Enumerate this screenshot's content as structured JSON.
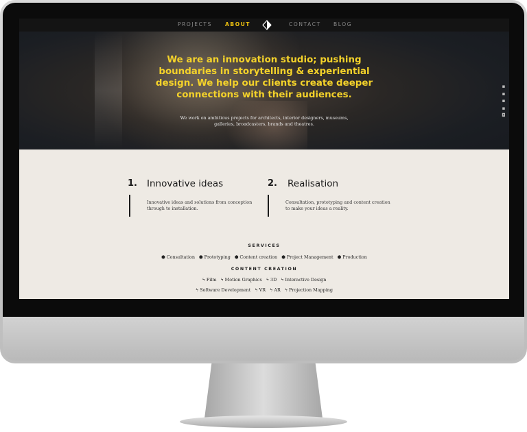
{
  "nav": {
    "items": [
      "PROJECTS",
      "ABOUT",
      "CONTACT",
      "BLOG"
    ],
    "active": "ABOUT"
  },
  "hero": {
    "title": "We are an innovation studio; pushing boundaries in storytelling & experiential design. We help our clients create deeper connections with their audiences.",
    "subtitle": "We work on ambitious projects for architects, interior designers, museums, galleries, broadcasters, brands and theatres."
  },
  "social": [
    "twitter-icon",
    "vimeo-icon",
    "linkedin-icon",
    "facebook-icon",
    "instagram-icon"
  ],
  "columns": [
    {
      "number": "1.",
      "heading": "Innovative ideas",
      "text": "Innovative ideas and solutions from conception through to installation."
    },
    {
      "number": "2.",
      "heading": "Realisation",
      "text": "Consultation, prototyping and content creation to make your ideas a reality."
    }
  ],
  "services": {
    "title": "SERVICES",
    "items": [
      "Consultation",
      "Prototyping",
      "Content creation",
      "Project Management",
      "Production"
    ]
  },
  "content_creation": {
    "title": "CONTENT CREATION",
    "row1": [
      "Film",
      "Motion Graphics",
      "3D",
      "Interactive Design"
    ],
    "row2": [
      "Software Development",
      "VR",
      "AR",
      "Projection Mapping"
    ]
  },
  "colors": {
    "accent": "#f4d22a",
    "nav_bg": "#141414",
    "content_bg": "#eeeae4"
  }
}
